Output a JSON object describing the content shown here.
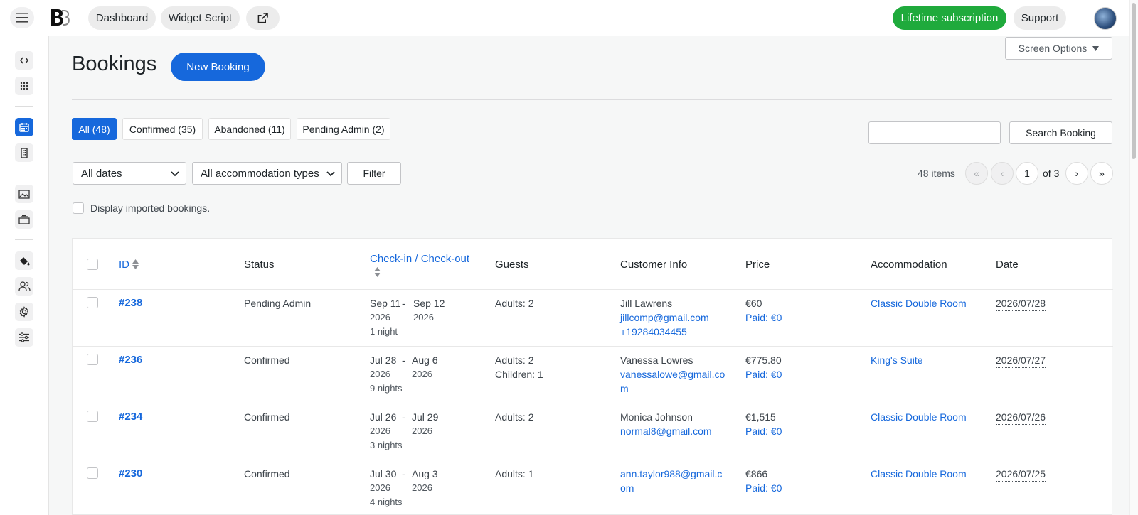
{
  "topbar": {
    "dashboard": "Dashboard",
    "widget_script": "Widget Script",
    "external_link_icon": "external-link-icon",
    "lifetime": "Lifetime subscription",
    "support": "Support"
  },
  "page": {
    "title": "Bookings",
    "new_booking": "New Booking",
    "screen_options": "Screen Options"
  },
  "status_filters": [
    {
      "label": "All (48)",
      "active": true
    },
    {
      "label": "Confirmed (35)"
    },
    {
      "label": "Abandoned (11)"
    },
    {
      "label": "Pending Admin (2)"
    }
  ],
  "search": {
    "button": "Search Booking",
    "value": ""
  },
  "filters": {
    "dates": "All dates",
    "accommodation": "All accommodation types",
    "filter_button": "Filter"
  },
  "pagination": {
    "items": "48 items",
    "first": "«",
    "prev": "‹",
    "current": "1",
    "of": "of 3",
    "next": "›",
    "last": "»"
  },
  "imported": {
    "label": "Display imported bookings."
  },
  "table": {
    "headers": {
      "id": "ID",
      "status": "Status",
      "checkin": "Check-in / Check-out",
      "guests": "Guests",
      "customer": "Customer Info",
      "price": "Price",
      "accommodation": "Accommodation",
      "date": "Date"
    },
    "rows": [
      {
        "id": "#238",
        "status": "Pending Admin",
        "checkin_md": "Sep 11",
        "checkin_y": "2026",
        "checkout_md": "Sep 12",
        "checkout_y": "2026",
        "nights": "1 night",
        "guests_1": "Adults: 2",
        "guests_2": "",
        "name": "Jill Lawrens",
        "email_1": "jillcomp@gmail.com",
        "email_2": "",
        "phone": "+19284034455",
        "price": "€60",
        "paid": "Paid: €0",
        "accommodation": "Classic Double Room",
        "date": "2026/07/28"
      },
      {
        "id": "#236",
        "status": "Confirmed",
        "checkin_md": "Jul 28",
        "checkin_y": "2026",
        "checkout_md": "Aug 6",
        "checkout_y": "2026",
        "nights": "9 nights",
        "guests_1": "Adults: 2",
        "guests_2": "Children: 1",
        "name": "Vanessa Lowres",
        "email_1": "vanessalowe@gmail.co",
        "email_2": "m",
        "phone": "",
        "price": "€775.80",
        "paid": "Paid: €0",
        "accommodation": "King's Suite",
        "date": "2026/07/27"
      },
      {
        "id": "#234",
        "status": "Confirmed",
        "checkin_md": "Jul 26",
        "checkin_y": "2026",
        "checkout_md": "Jul 29",
        "checkout_y": "2026",
        "nights": "3 nights",
        "guests_1": "Adults: 2",
        "guests_2": "",
        "name": "Monica Johnson",
        "email_1": "normal8@gmail.com",
        "email_2": "",
        "phone": "",
        "price": "€1,515",
        "paid": "Paid: €0",
        "accommodation": "Classic Double Room",
        "date": "2026/07/26"
      },
      {
        "id": "#230",
        "status": "Confirmed",
        "checkin_md": "Jul 30",
        "checkin_y": "2026",
        "checkout_md": "Aug 3",
        "checkout_y": "2026",
        "nights": "4 nights",
        "guests_1": "Adults: 1",
        "guests_2": "",
        "name": "",
        "email_1": "ann.taylor988@gmail.c",
        "email_2": "om",
        "phone": "",
        "price": "€866",
        "paid": "Paid: €0",
        "accommodation": "Classic Double Room",
        "date": "2026/07/25"
      }
    ]
  }
}
